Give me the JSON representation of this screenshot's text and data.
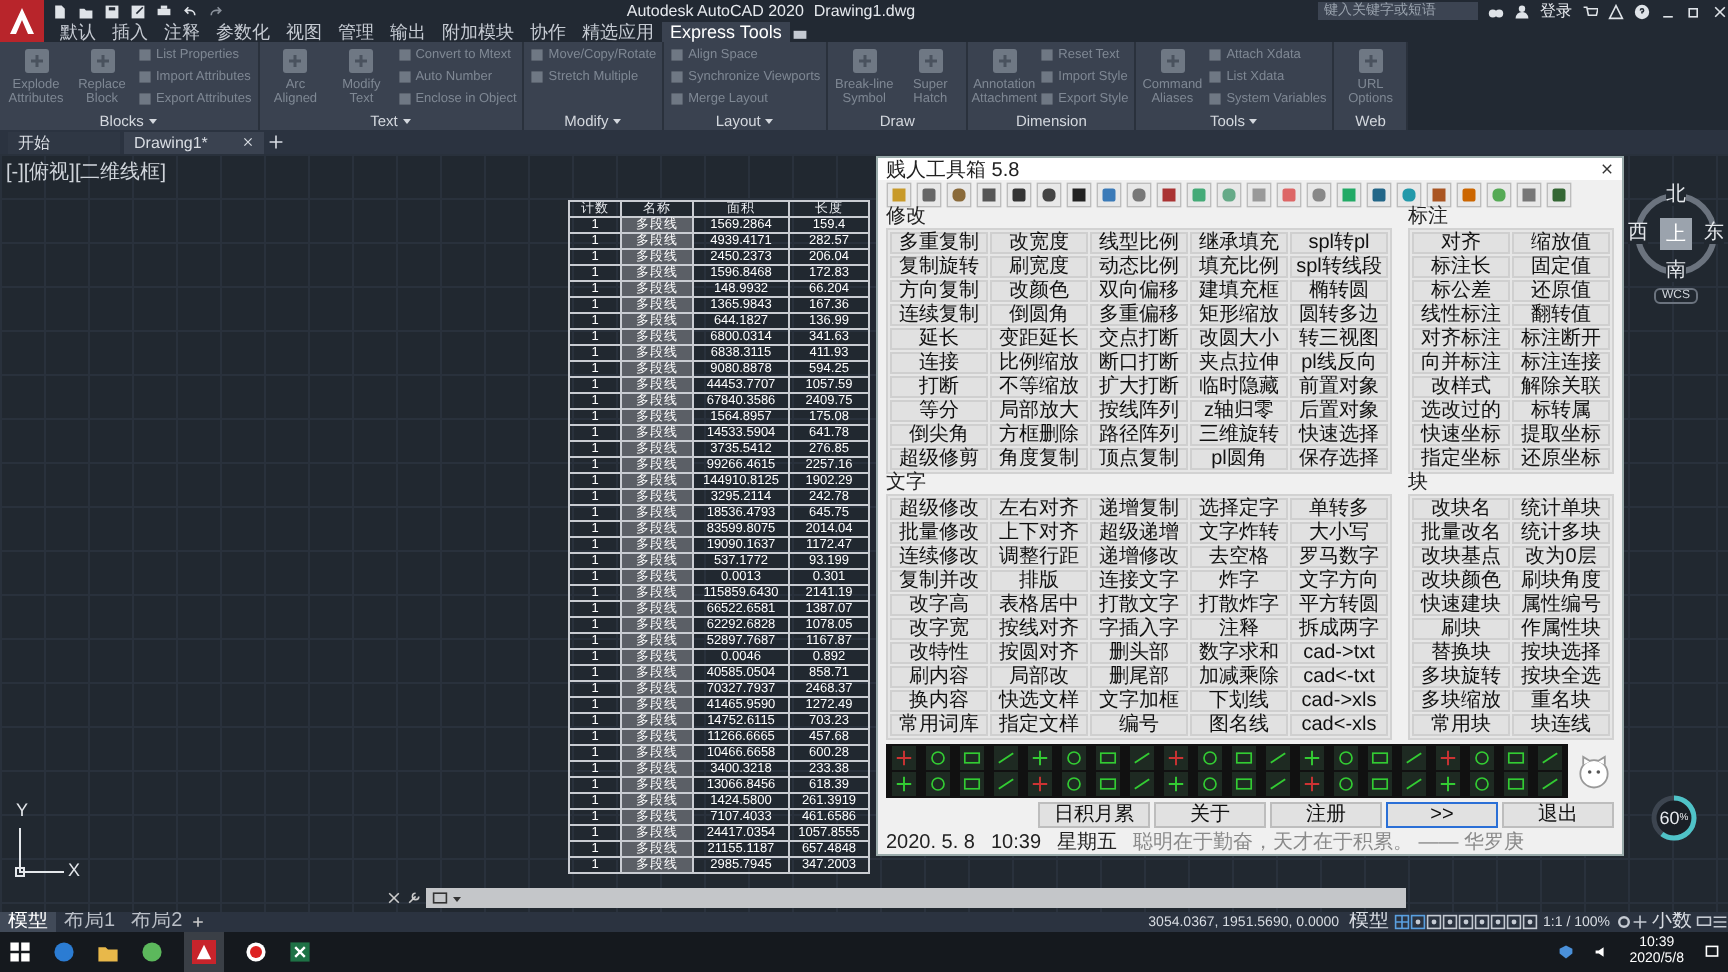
{
  "app": {
    "title": "Autodesk AutoCAD 2020",
    "document": "Drawing1.dwg",
    "search": {
      "placeholder": "键入关键字或短语"
    },
    "sign_in": "登录"
  },
  "ribbon_tabs": [
    {
      "label": "默认",
      "selected": false
    },
    {
      "label": "插入",
      "selected": false
    },
    {
      "label": "注释",
      "selected": false
    },
    {
      "label": "参数化",
      "selected": false
    },
    {
      "label": "视图",
      "selected": false
    },
    {
      "label": "管理",
      "selected": false
    },
    {
      "label": "输出",
      "selected": false
    },
    {
      "label": "附加模块",
      "selected": false
    },
    {
      "label": "协作",
      "selected": false
    },
    {
      "label": "精选应用",
      "selected": false
    },
    {
      "label": "Express Tools",
      "selected": true
    }
  ],
  "ribbon_panels": [
    {
      "title": "Blocks",
      "menu": true,
      "items": [
        {
          "kind": "large",
          "label": "Explode Attributes"
        },
        {
          "kind": "large",
          "label": "Replace Block"
        },
        {
          "kind": "small",
          "label": "List Properties"
        },
        {
          "kind": "small",
          "label": "Import Attributes"
        },
        {
          "kind": "small",
          "label": "Export Attributes"
        }
      ]
    },
    {
      "title": "Text",
      "menu": true,
      "items": [
        {
          "kind": "large",
          "label": "Arc Aligned"
        },
        {
          "kind": "large",
          "label": "Modify Text"
        },
        {
          "kind": "small",
          "label": "Convert to Mtext"
        },
        {
          "kind": "small",
          "label": "Auto Number"
        },
        {
          "kind": "small",
          "label": "Enclose in Object"
        }
      ]
    },
    {
      "title": "Modify",
      "menu": true,
      "items": [
        {
          "kind": "small",
          "label": "Move/Copy/Rotate"
        },
        {
          "kind": "small",
          "label": "Stretch Multiple"
        }
      ]
    },
    {
      "title": "Layout",
      "menu": true,
      "items": [
        {
          "kind": "small",
          "label": "Align Space"
        },
        {
          "kind": "small",
          "label": "Synchronize Viewports"
        },
        {
          "kind": "small",
          "label": "Merge Layout"
        }
      ]
    },
    {
      "title": "Draw",
      "menu": false,
      "items": [
        {
          "kind": "large",
          "label": "Break-line Symbol"
        },
        {
          "kind": "large",
          "label": "Super Hatch"
        }
      ]
    },
    {
      "title": "Dimension",
      "menu": false,
      "items": [
        {
          "kind": "large",
          "label": "Annotation Attachment"
        },
        {
          "kind": "small",
          "label": "Reset Text"
        },
        {
          "kind": "small",
          "label": "Import Style"
        },
        {
          "kind": "small",
          "label": "Export Style"
        }
      ]
    },
    {
      "title": "Tools",
      "menu": true,
      "items": [
        {
          "kind": "large",
          "label": "Command Aliases"
        },
        {
          "kind": "small",
          "label": "Attach Xdata"
        },
        {
          "kind": "small",
          "label": "List Xdata"
        },
        {
          "kind": "small",
          "label": "System Variables"
        }
      ]
    },
    {
      "title": "Web",
      "menu": false,
      "items": [
        {
          "kind": "large",
          "label": "URL Options"
        }
      ]
    }
  ],
  "file_tabs": [
    {
      "label": "开始",
      "selected": false
    },
    {
      "label": "Drawing1*",
      "selected": true
    }
  ],
  "viewport_label": "[-][俯视][二维线框]",
  "table": {
    "columns": [
      "计数",
      "名称",
      "面积",
      "长度"
    ],
    "rows": [
      [
        "1",
        "多段线",
        "1569.2864",
        "159.4"
      ],
      [
        "1",
        "多段线",
        "4939.4171",
        "282.57"
      ],
      [
        "1",
        "多段线",
        "2450.2373",
        "206.04"
      ],
      [
        "1",
        "多段线",
        "1596.8468",
        "172.83"
      ],
      [
        "1",
        "多段线",
        "148.9932",
        "66.204"
      ],
      [
        "1",
        "多段线",
        "1365.9843",
        "167.36"
      ],
      [
        "1",
        "多段线",
        "644.1827",
        "136.99"
      ],
      [
        "1",
        "多段线",
        "6800.0314",
        "341.63"
      ],
      [
        "1",
        "多段线",
        "6838.3115",
        "411.93"
      ],
      [
        "1",
        "多段线",
        "9080.8878",
        "594.25"
      ],
      [
        "1",
        "多段线",
        "44453.7707",
        "1057.59"
      ],
      [
        "1",
        "多段线",
        "67840.3586",
        "2409.75"
      ],
      [
        "1",
        "多段线",
        "1564.8957",
        "175.08"
      ],
      [
        "1",
        "多段线",
        "14533.5904",
        "641.78"
      ],
      [
        "1",
        "多段线",
        "3735.5412",
        "276.85"
      ],
      [
        "1",
        "多段线",
        "99266.4615",
        "2257.16"
      ],
      [
        "1",
        "多段线",
        "144910.8125",
        "1902.29"
      ],
      [
        "1",
        "多段线",
        "3295.2114",
        "242.78"
      ],
      [
        "1",
        "多段线",
        "18536.4793",
        "645.75"
      ],
      [
        "1",
        "多段线",
        "83599.8075",
        "2014.04"
      ],
      [
        "1",
        "多段线",
        "19090.1637",
        "1172.47"
      ],
      [
        "1",
        "多段线",
        "537.1772",
        "93.199"
      ],
      [
        "1",
        "多段线",
        "0.0013",
        "0.301"
      ],
      [
        "1",
        "多段线",
        "115859.6430",
        "2141.19"
      ],
      [
        "1",
        "多段线",
        "66522.6581",
        "1387.07"
      ],
      [
        "1",
        "多段线",
        "62292.6828",
        "1078.05"
      ],
      [
        "1",
        "多段线",
        "52897.7687",
        "1167.87"
      ],
      [
        "1",
        "多段线",
        "0.0046",
        "0.892"
      ],
      [
        "1",
        "多段线",
        "40585.0504",
        "858.71"
      ],
      [
        "1",
        "多段线",
        "70327.7937",
        "2468.37"
      ],
      [
        "1",
        "多段线",
        "41465.9590",
        "1272.49"
      ],
      [
        "1",
        "多段线",
        "14752.6115",
        "703.23"
      ],
      [
        "1",
        "多段线",
        "11266.6665",
        "457.68"
      ],
      [
        "1",
        "多段线",
        "10466.6658",
        "600.28"
      ],
      [
        "1",
        "多段线",
        "3400.3218",
        "233.38"
      ],
      [
        "1",
        "多段线",
        "13066.8456",
        "618.39"
      ],
      [
        "1",
        "多段线",
        "1424.5800",
        "261.3919"
      ],
      [
        "1",
        "多段线",
        "7107.4033",
        "461.6586"
      ],
      [
        "1",
        "多段线",
        "24417.0354",
        "1057.8555"
      ],
      [
        "1",
        "多段线",
        "21155.1187",
        "657.4848"
      ],
      [
        "1",
        "多段线",
        "2985.7945",
        "347.2003"
      ]
    ]
  },
  "dialog": {
    "title": "贱人工具箱 5.8",
    "sections": [
      {
        "title": "修改",
        "kind": "wide",
        "buttons": [
          "多重复制",
          "改宽度",
          "线型比例",
          "继承填充",
          "spl转pl",
          "复制旋转",
          "刷宽度",
          "动态比例",
          "填充比例",
          "spl转线段",
          "方向复制",
          "改颜色",
          "双向偏移",
          "建填充框",
          "椭转圆",
          "连续复制",
          "倒圆角",
          "多重偏移",
          "矩形缩放",
          "圆转多边",
          "延长",
          "变距延长",
          "交点打断",
          "改圆大小",
          "转三视图",
          "连接",
          "比例缩放",
          "断口打断",
          "夹点拉伸",
          "pl线反向",
          "打断",
          "不等缩放",
          "扩大打断",
          "临时隐藏",
          "前置对象",
          "等分",
          "局部放大",
          "按线阵列",
          "z轴归零",
          "后置对象",
          "倒尖角",
          "方框删除",
          "路径阵列",
          "三维旋转",
          "快速选择",
          "超级修剪",
          "角度复制",
          "顶点复制",
          "pl圆角",
          "保存选择"
        ]
      },
      {
        "title": "标注",
        "kind": "narrow",
        "buttons": [
          "对齐",
          "缩放值",
          "标注长",
          "固定值",
          "标公差",
          "还原值",
          "线性标注",
          "翻转值",
          "对齐标注",
          "标注断开",
          "向并标注",
          "标注连接",
          "改样式",
          "解除关联",
          "选改过的",
          "标转属",
          "快速坐标",
          "提取坐标",
          "指定坐标",
          "还原坐标"
        ]
      },
      {
        "title": "文字",
        "kind": "wide",
        "buttons": [
          "超级修改",
          "左右对齐",
          "递增复制",
          "选择定字",
          "单转多",
          "批量修改",
          "上下对齐",
          "超级递增",
          "文字炸转",
          "大小写",
          "连续修改",
          "调整行距",
          "递增修改",
          "去空格",
          "罗马数字",
          "复制并改",
          "排版",
          "连接文字",
          "炸字",
          "文字方向",
          "改字高",
          "表格居中",
          "打散文字",
          "打散炸字",
          "平方转圆",
          "改字宽",
          "按线对齐",
          "字插入字",
          "注释",
          "拆成两字",
          "改特性",
          "按圆对齐",
          "删头部",
          "数字求和",
          "cad->txt",
          "刷内容",
          "局部改",
          "删尾部",
          "加减乘除",
          "cad<-txt",
          "换内容",
          "快选文样",
          "文字加框",
          "下划线",
          "cad->xls",
          "常用词库",
          "指定文样",
          "编号",
          "图名线",
          "cad<-xls"
        ]
      },
      {
        "title": "块",
        "kind": "narrow",
        "buttons": [
          "改块名",
          "统计单块",
          "批量改名",
          "统计多块",
          "改块基点",
          "改为0层",
          "改块颜色",
          "刷块角度",
          "快速建块",
          "属性编号",
          "刷块",
          "作属性块",
          "替换块",
          "按块选择",
          "多块旋转",
          "按块全选",
          "多块缩放",
          "重名块",
          "常用块",
          "块连线"
        ]
      }
    ],
    "bottom_buttons": [
      {
        "label": "日积月累",
        "selected": false
      },
      {
        "label": "关于",
        "selected": false
      },
      {
        "label": "注册",
        "selected": false
      },
      {
        "label": ">>",
        "selected": true
      },
      {
        "label": "退出",
        "selected": false
      }
    ],
    "date": "2020. 5. 8",
    "time": "10:39",
    "weekday": "星期五",
    "motto": "聪明在于勤奋，天才在于积累。 —— 华罗庚"
  },
  "viewcube": {
    "north": "北",
    "west": "西",
    "east": "东",
    "south": "南",
    "top": "上",
    "wcs": "WCS"
  },
  "ucs": {
    "x": "X",
    "y": "Y"
  },
  "gauge": {
    "value": "60",
    "unit": "%"
  },
  "layout_tabs": [
    {
      "label": "模型",
      "selected": true
    },
    {
      "label": "布局1",
      "selected": false
    },
    {
      "label": "布局2",
      "selected": false
    }
  ],
  "status_bar": {
    "coordinates": "3054.0367, 1951.5690, 0.0000",
    "space": "模型",
    "scale": "1:1 / 100%",
    "units": "小数"
  },
  "taskbar": {
    "time": "10:39",
    "date": "2020/5/8"
  }
}
